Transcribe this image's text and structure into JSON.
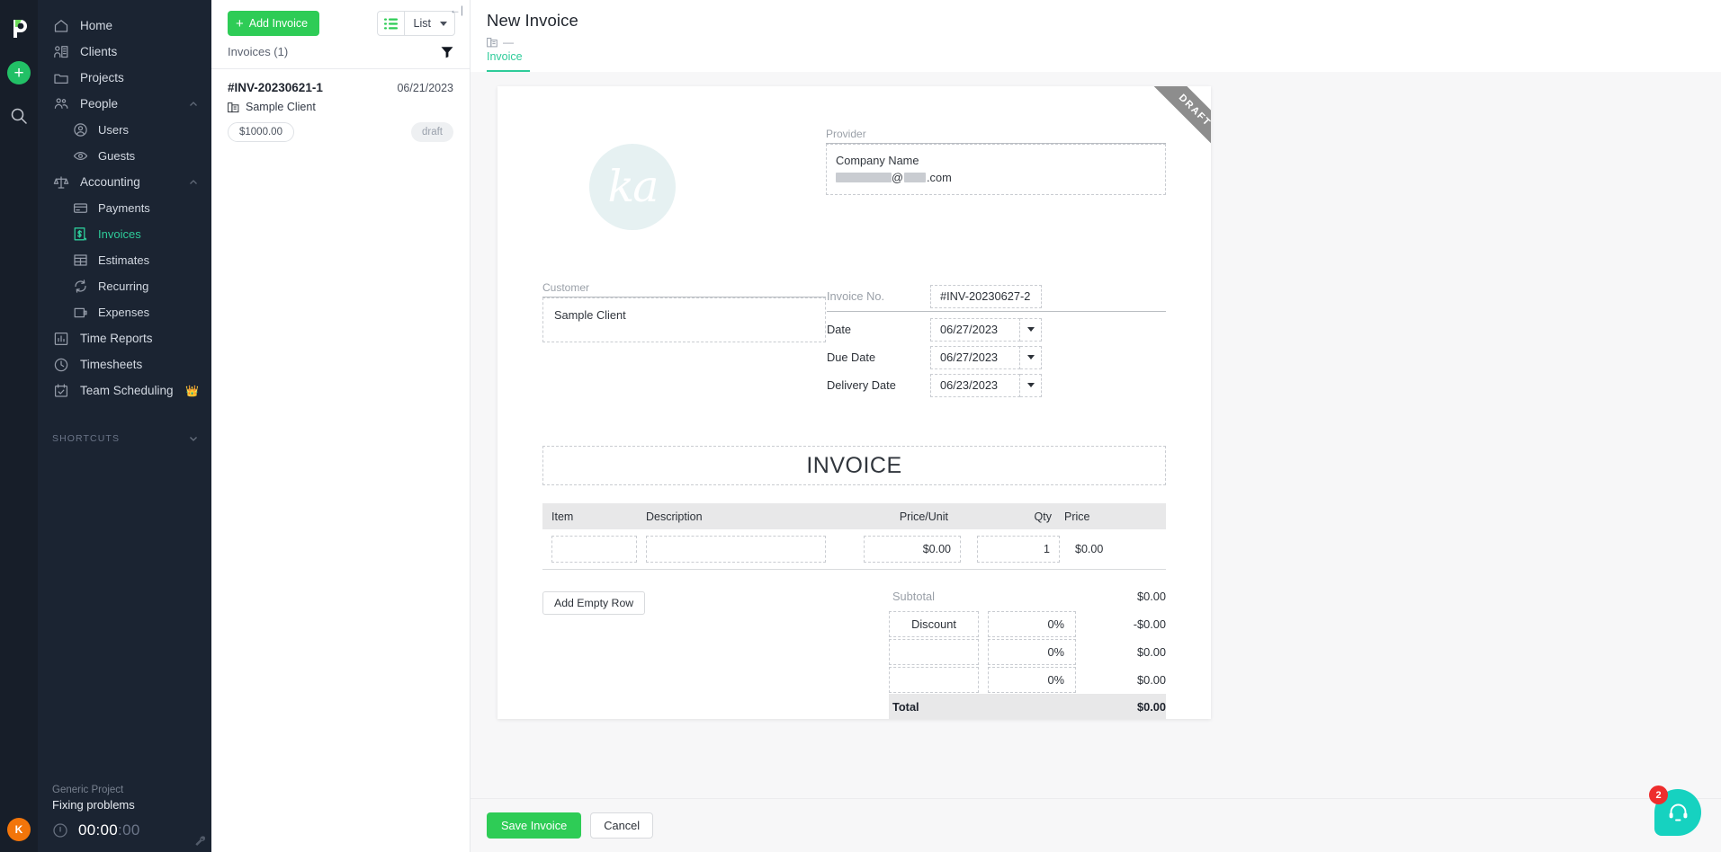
{
  "rail": {
    "logo_name": "app-logo",
    "plus_label": "+",
    "avatar_initial": "K"
  },
  "sidebar": {
    "items": [
      {
        "label": "Home",
        "icon": "home-icon",
        "level": 0,
        "active": false
      },
      {
        "label": "Clients",
        "icon": "clients-icon",
        "level": 0,
        "active": false
      },
      {
        "label": "Projects",
        "icon": "folder-icon",
        "level": 0,
        "active": false
      },
      {
        "label": "People",
        "icon": "people-icon",
        "level": 0,
        "active": false,
        "expanded": true
      },
      {
        "label": "Users",
        "icon": "user-circle-icon",
        "level": 1,
        "active": false
      },
      {
        "label": "Guests",
        "icon": "eye-icon",
        "level": 1,
        "active": false
      },
      {
        "label": "Accounting",
        "icon": "scales-icon",
        "level": 0,
        "active": false,
        "expanded": true
      },
      {
        "label": "Payments",
        "icon": "credit-card-icon",
        "level": 1,
        "active": false
      },
      {
        "label": "Invoices",
        "icon": "invoice-dollar-icon",
        "level": 1,
        "active": true
      },
      {
        "label": "Estimates",
        "icon": "table-icon",
        "level": 1,
        "active": false
      },
      {
        "label": "Recurring",
        "icon": "refresh-icon",
        "level": 1,
        "active": false
      },
      {
        "label": "Expenses",
        "icon": "wallet-icon",
        "level": 1,
        "active": false
      },
      {
        "label": "Time Reports",
        "icon": "bar-chart-icon",
        "level": 0,
        "active": false
      },
      {
        "label": "Timesheets",
        "icon": "clock-icon",
        "level": 0,
        "active": false
      },
      {
        "label": "Team Scheduling",
        "icon": "calendar-check-icon",
        "level": 0,
        "active": false,
        "premium": true
      }
    ],
    "shortcuts_label": "SHORTCUTS",
    "timer": {
      "project": "Generic Project",
      "task": "Fixing problems",
      "elapsed_main": "00:00",
      "elapsed_seconds": ":00"
    }
  },
  "list_panel": {
    "add_button": "Add Invoice",
    "view_mode": "List",
    "count_label": "Invoices (1)",
    "collapse_icon": "←|",
    "invoices": [
      {
        "number": "#INV-20230621-1",
        "date": "06/21/2023",
        "client": "Sample Client",
        "amount": "$1000.00",
        "status": "draft"
      }
    ]
  },
  "header": {
    "title": "New Invoice",
    "subtitle": "—",
    "tabs": [
      {
        "label": "Invoice",
        "active": true
      }
    ]
  },
  "document": {
    "ribbon": "DRAFT",
    "logo_text": "ka",
    "provider": {
      "label": "Provider",
      "company": "Company Name",
      "email_suffix": ".com",
      "email_at": "@"
    },
    "customer": {
      "label": "Customer",
      "value": "Sample Client"
    },
    "meta": [
      {
        "label": "Invoice No.",
        "value": "#INV-20230627-2",
        "dropdown": false
      },
      {
        "label": "Date",
        "value": "06/27/2023",
        "dropdown": true
      },
      {
        "label": "Due Date",
        "value": "06/27/2023",
        "dropdown": true
      },
      {
        "label": "Delivery Date",
        "value": "06/23/2023",
        "dropdown": true
      }
    ],
    "doc_title": "INVOICE",
    "table": {
      "columns": [
        "Item",
        "Description",
        "Price/Unit",
        "Qty",
        "Price"
      ],
      "rows": [
        {
          "item": "",
          "description": "",
          "price_unit": "$0.00",
          "qty": "1",
          "price": "$0.00"
        }
      ]
    },
    "add_row_button": "Add Empty Row",
    "totals": [
      {
        "name": "Subtotal",
        "name_editable": false,
        "pct": "",
        "amount": "$0.00"
      },
      {
        "name": "Discount",
        "name_editable": true,
        "pct": "0%",
        "amount": "-$0.00"
      },
      {
        "name": "",
        "name_editable": true,
        "pct": "0%",
        "amount": "$0.00"
      },
      {
        "name": "",
        "name_editable": true,
        "pct": "0%",
        "amount": "$0.00"
      }
    ],
    "total_label": "Total",
    "total_amount": "$0.00"
  },
  "footer": {
    "save_label": "Save Invoice",
    "cancel_label": "Cancel"
  },
  "chat": {
    "badge": "2"
  },
  "colors": {
    "accent_green": "#2ecc56",
    "accent_teal": "#2ecc9a",
    "sidebar_bg": "#1b2432",
    "rail_bg": "#171e29",
    "chat_teal": "#16d2c0",
    "badge_red": "#ee2d2d",
    "avatar_orange": "#f2750a",
    "crown_gold": "#f0a820",
    "ribbon_gray": "#8d8d8d"
  }
}
